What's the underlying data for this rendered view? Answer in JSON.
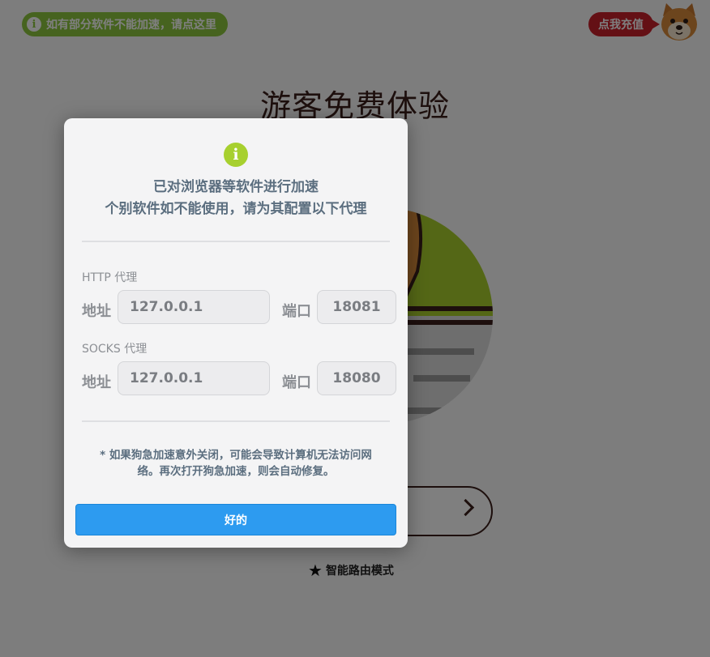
{
  "background": {
    "notice": {
      "text": "如有部分软件不能加速，请点这里",
      "icon": "info-icon"
    },
    "recharge_label": "点我充值",
    "title": "游客免费体验",
    "smart_mode": {
      "label": "智能路由模式",
      "icon": "star-icon"
    },
    "start_button_icon": "chevron-right-icon"
  },
  "dialog": {
    "icon": "info-icon",
    "title_line1": "已对浏览器等软件进行加速",
    "title_line2": "个别软件如不能使用，请为其配置以下代理",
    "http": {
      "section_label": "HTTP 代理",
      "address_label": "地址",
      "address_value": "127.0.0.1",
      "port_label": "端口",
      "port_value": "18081"
    },
    "socks": {
      "section_label": "SOCKS 代理",
      "address_label": "地址",
      "address_value": "127.0.0.1",
      "port_label": "端口",
      "port_value": "18080"
    },
    "footnote_line1": "* 如果狗急加速意外关闭，可能会导致计算机无法访问网",
    "footnote_line2": "络。再次打开狗急加速，则会自动修复。",
    "ok_label": "好的"
  },
  "colors": {
    "accent": "#2d9bf0",
    "notice_green": "#8dc63f",
    "info_green": "#a7d02f",
    "recharge_red": "#c8202b",
    "text_slate": "#5b6e7f"
  }
}
